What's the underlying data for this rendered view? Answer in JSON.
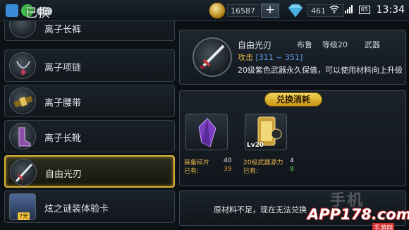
{
  "header": {
    "title": "已换",
    "coins": "16587",
    "gems": "461",
    "plus_label": "+",
    "battery": "65",
    "time": "13:34"
  },
  "items": [
    {
      "name": "离子长裤"
    },
    {
      "name": "离子项链"
    },
    {
      "name": "离子腰带"
    },
    {
      "name": "离子长靴"
    },
    {
      "name": "自由光刃"
    },
    {
      "name": "炫之谜装体验卡",
      "badge": "7天"
    }
  ],
  "detail": {
    "name": "自由光刃",
    "owner": "布鲁",
    "level": "等级20",
    "kind": "武器",
    "attack_label": "攻击",
    "attack_range": "[311 ~ 351]",
    "description": "20级紫色武器永久保值，可以使用材料向上升级"
  },
  "exchange": {
    "title": "兑换消耗",
    "owned_label": "已有:",
    "materials": [
      {
        "name": "装备碎片",
        "need": "40",
        "owned": "39",
        "owned_color": "#e0912f"
      },
      {
        "name": "20级武器源力",
        "need": "4",
        "owned": "8",
        "owned_color": "#5fd35a",
        "badge": "Lv20"
      }
    ]
  },
  "footer": {
    "message": "原材料不足，现在无法兑换"
  },
  "watermark": {
    "text": "手机",
    "site": "APP178.com",
    "tag": "手游网"
  },
  "colors": {
    "gold_accent": "#d9b337",
    "attack": "#e3b548",
    "range": "#5da0f0",
    "panel_border": "#3c4957"
  }
}
